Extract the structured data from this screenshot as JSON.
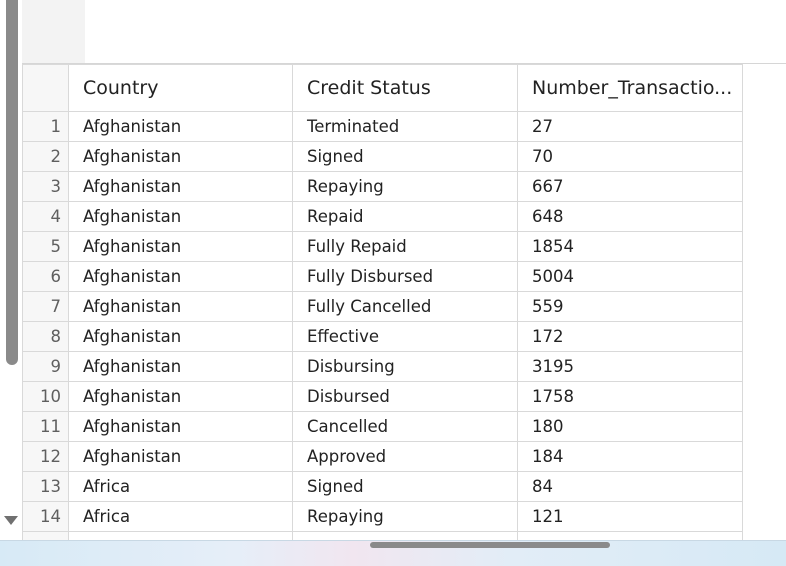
{
  "table": {
    "columns": [
      "Country",
      "Credit Status",
      "Number_Transactio..."
    ],
    "rows": [
      {
        "index": "1",
        "country": "Afghanistan",
        "status": "Terminated",
        "count": "27"
      },
      {
        "index": "2",
        "country": "Afghanistan",
        "status": "Signed",
        "count": "70"
      },
      {
        "index": "3",
        "country": "Afghanistan",
        "status": "Repaying",
        "count": "667"
      },
      {
        "index": "4",
        "country": "Afghanistan",
        "status": "Repaid",
        "count": "648"
      },
      {
        "index": "5",
        "country": "Afghanistan",
        "status": "Fully Repaid",
        "count": "1854"
      },
      {
        "index": "6",
        "country": "Afghanistan",
        "status": "Fully Disbursed",
        "count": "5004"
      },
      {
        "index": "7",
        "country": "Afghanistan",
        "status": "Fully Cancelled",
        "count": "559"
      },
      {
        "index": "8",
        "country": "Afghanistan",
        "status": "Effective",
        "count": "172"
      },
      {
        "index": "9",
        "country": "Afghanistan",
        "status": "Disbursing",
        "count": "3195"
      },
      {
        "index": "10",
        "country": "Afghanistan",
        "status": "Disbursed",
        "count": "1758"
      },
      {
        "index": "11",
        "country": "Afghanistan",
        "status": "Cancelled",
        "count": "180"
      },
      {
        "index": "12",
        "country": "Afghanistan",
        "status": "Approved",
        "count": "184"
      },
      {
        "index": "13",
        "country": "Africa",
        "status": "Signed",
        "count": "84"
      },
      {
        "index": "14",
        "country": "Africa",
        "status": "Repaying",
        "count": "121"
      }
    ]
  },
  "icons": {
    "scroll_down": "triangle-down-icon"
  },
  "colors": {
    "grid_border": "#d9d9d9",
    "index_text": "#5f5f5f",
    "scrollbar": "#8a8a8a"
  }
}
